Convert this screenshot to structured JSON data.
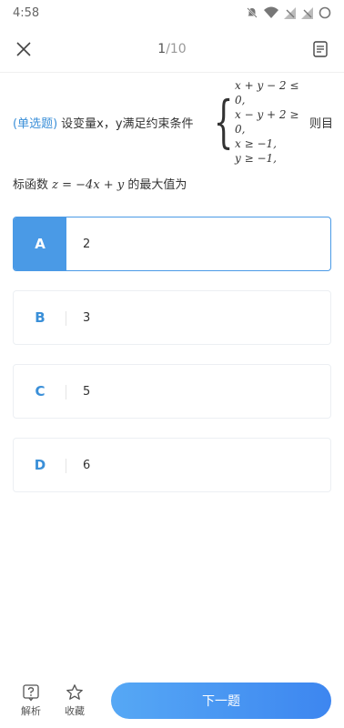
{
  "status": {
    "time": "4:58"
  },
  "nav": {
    "current": "1",
    "total": "/10"
  },
  "question": {
    "type_label": "(单选题)",
    "prefix": "设变量x，y满足约束条件",
    "constraints": [
      "x + y − 2 ≤ 0,",
      "x − y + 2 ≥ 0,",
      "x ≥ −1,",
      "y ≥ −1,"
    ],
    "suffix": "则目",
    "line2_pre": "标函数",
    "line2_math": "z = −4x + y",
    "line2_post": "的最大值为"
  },
  "options": [
    {
      "letter": "A",
      "value": "2"
    },
    {
      "letter": "B",
      "value": "3"
    },
    {
      "letter": "C",
      "value": "5"
    },
    {
      "letter": "D",
      "value": "6"
    }
  ],
  "bottom": {
    "analysis_label": "解析",
    "favorite_label": "收藏",
    "next_label": "下一题"
  },
  "colors": {
    "accent": "#4a9ae6",
    "type_label": "#3a8fd8"
  }
}
